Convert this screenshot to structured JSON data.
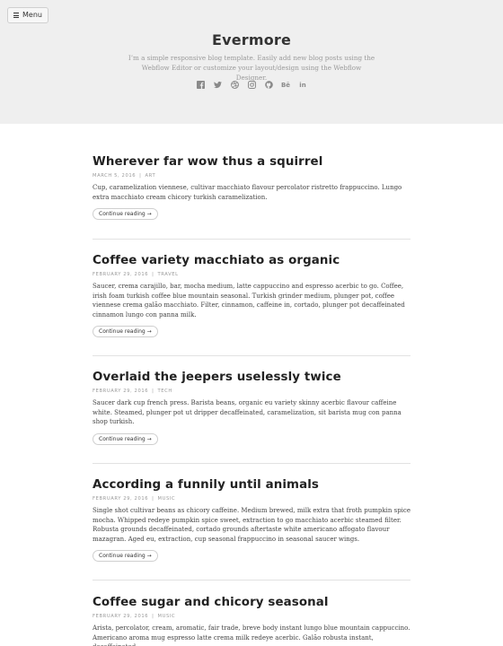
{
  "header": {
    "menu_label": "Menu",
    "site_title": "Evermore",
    "description": "I’m a simple responsive blog template. Easily add new blog posts using the Webflow Editor or customize your layout/design using the Webflow Designer.",
    "social_icons": [
      "facebook-icon",
      "twitter-icon",
      "dribbble-icon",
      "instagram-icon",
      "github-icon",
      "behance-icon",
      "linkedin-icon"
    ]
  },
  "posts": [
    {
      "title": "Wherever far wow thus a squirrel",
      "date": "March 5, 2016",
      "category": "Art",
      "excerpt": "Cup, caramelization viennese, cultivar macchiato flavour percolator ristretto frappuccino. Lungo extra macchiato cream chicory turkish caramelization.",
      "continue_label": "Continue reading →"
    },
    {
      "title": "Coffee variety macchiato as organic",
      "date": "February 29, 2016",
      "category": "Travel",
      "excerpt": "Saucer, crema carajillo, bar, mocha medium, latte cappuccino and espresso acerbic to go. Coffee, irish foam turkish coffee blue mountain seasonal. Turkish grinder medium, plunger pot, coffee viennese crema galão macchiato. Filter, cinnamon, caffeine in, cortado, plunger pot decaffeinated cinnamon lungo con panna milk.",
      "continue_label": "Continue reading →"
    },
    {
      "title": "Overlaid the jeepers uselessly twice",
      "date": "February 29, 2016",
      "category": "Tech",
      "excerpt": "Saucer dark cup french press. Barista beans, organic eu variety skinny acerbic flavour caffeine white. Steamed, plunger pot ut dripper decaffeinated, caramelization, sit barista mug con panna shop turkish.",
      "continue_label": "Continue reading →"
    },
    {
      "title": "According a funnily until animals",
      "date": "February 29, 2016",
      "category": "Music",
      "excerpt": "Single shot cultivar beans as chicory caffeine. Medium brewed, milk extra that froth pumpkin spice mocha. Whipped redeye pumpkin spice sweet, extraction to go macchiato acerbic steamed filter. Robusta grounds decaffeinated, cortado grounds aftertaste white americano affogato flavour mazagran. Aged eu, extraction, cup seasonal frappuccino in seasonal saucer wings.",
      "continue_label": "Continue reading →"
    },
    {
      "title": "Coffee sugar and chicory seasonal",
      "date": "February 29, 2016",
      "category": "Music",
      "excerpt": "Arista, percolator, cream, aromatic, fair trade, breve body instant lungo blue mountain cappuccino. Americano aroma mug espresso latte crema milk redeye acerbic. Galão robusta instant, decaffeinated,",
      "continue_label": ""
    }
  ]
}
